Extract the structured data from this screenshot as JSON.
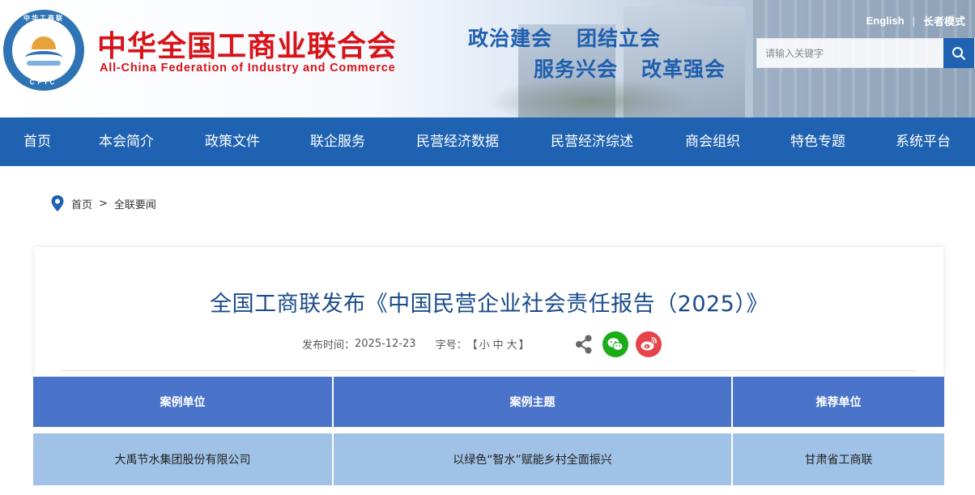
{
  "header": {
    "logo_top_text": "中华工商联",
    "logo_bottom_text": "CFIC",
    "brand_cn": "中华全国工商业联合会",
    "brand_en": "All-China Federation of Industry and Commerce",
    "slogans": [
      "政治建会",
      "团结立会",
      "服务兴会",
      "改革强会"
    ],
    "links": {
      "english": "English",
      "separator": "|",
      "elder_mode": "长者模式"
    },
    "search": {
      "placeholder": "请输入关键字"
    }
  },
  "nav": {
    "items": [
      "首页",
      "本会简介",
      "政策文件",
      "联企服务",
      "民营经济数据",
      "民营经济综述",
      "商会组织",
      "特色专题",
      "系统平台"
    ]
  },
  "breadcrumb": {
    "home": "首页",
    "separator": ">",
    "current": "全联要闻"
  },
  "article": {
    "title": "全国工商联发布《中国民营企业社会责任报告（2025）》",
    "publish_label": "发布时间：",
    "publish_date": "2025-12-23",
    "font_size_label": "字号：",
    "font_open": "【",
    "font_small": "小",
    "font_medium": "中",
    "font_large": "大",
    "font_close": "】"
  },
  "table": {
    "headers": [
      "案例单位",
      "案例主题",
      "推荐单位"
    ],
    "rows": [
      [
        "大禹节水集团股份有限公司",
        "以绿色“智水”赋能乡村全面振兴",
        "甘肃省工商联"
      ]
    ]
  },
  "colors": {
    "brand_red": "#d7141a",
    "nav_blue": "#1f62b1",
    "title_blue": "#1a4c8b",
    "table_header": "#4a74c9",
    "table_row": "#9fc2e6"
  }
}
